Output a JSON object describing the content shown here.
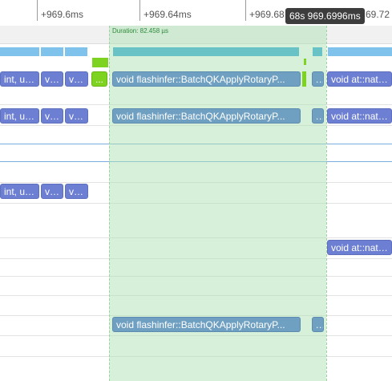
{
  "ruler": {
    "ticks": [
      "+969.6ms",
      "+969.64ms",
      "+969.68",
      "69.72"
    ],
    "cursor_label": "68s 969.6996ms"
  },
  "selection": {
    "duration_label": "Duration: 82.458 µs"
  },
  "rows": {
    "r1": {
      "a": "int, un...",
      "b": "voi...",
      "c": "voi...",
      "d": "...",
      "e": "void flashinfer::BatchQKApplyRotaryP...",
      "f": "...",
      "g": "void at::native"
    },
    "r2": {
      "a": "int, un...",
      "b": "voi...",
      "c": "voi...",
      "e": "void flashinfer::BatchQKApplyRotaryP...",
      "f": "...",
      "g": "void at::native"
    },
    "r3": {
      "a": "int, un...",
      "b": "voi...",
      "c": "voi..."
    },
    "r4": {
      "g": "void at::native"
    },
    "r5": {
      "e": "void flashinfer::BatchQKApplyRotaryP...",
      "f": "..."
    }
  },
  "colors": {
    "kernel_block": "#6d7fd2",
    "selected_block": "#6fa0c2",
    "green_block": "#7ed321",
    "selection_fill": "#aee2b4"
  }
}
